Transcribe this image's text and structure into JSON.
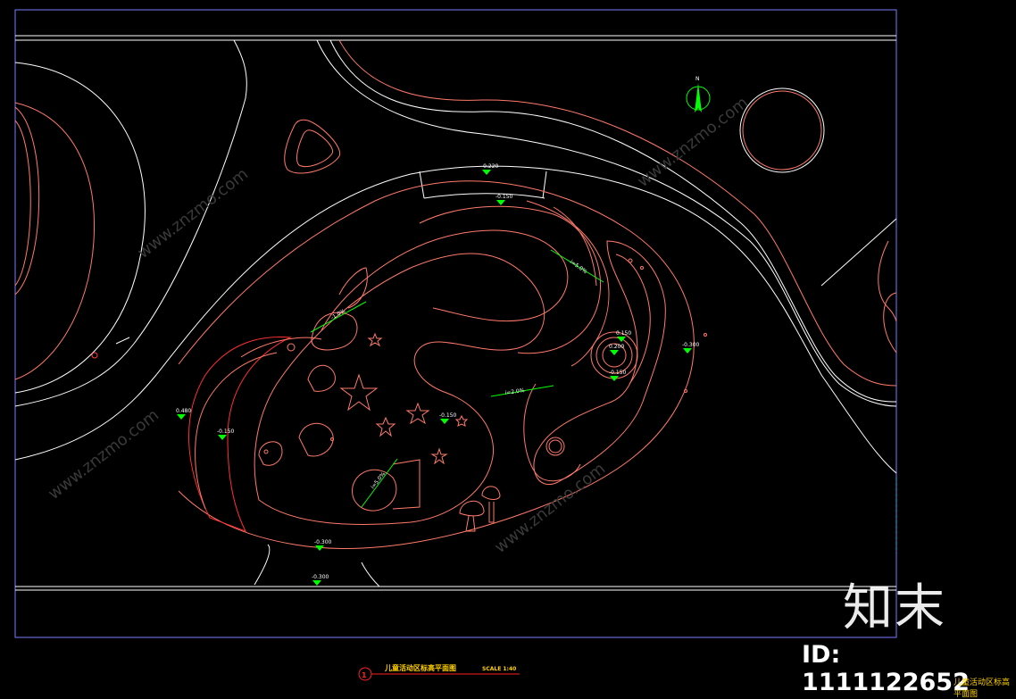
{
  "drawing": {
    "title": "儿童活动区标高平面图",
    "scale": "SCALE 1:40",
    "index_number": "1",
    "colors": {
      "boundary": "#ffffff",
      "frame": "#7a7aff",
      "plan": "#ff7a6a",
      "elevation_marker": "#00ff00",
      "label": "#ffffff",
      "title": "#ffd000",
      "index_circle": "#ff2020"
    },
    "north_arrow_label": "N"
  },
  "elevations": [
    "-0.220",
    "-0.150",
    "-0.150",
    "0.480",
    "-0.150",
    "0.200",
    "-0.150",
    "0.150",
    "-0.150",
    "-0.300",
    "-0.300",
    "-0.300",
    "-0.300"
  ],
  "slopes": [
    "-1.0%",
    "i=5.0%",
    "i=2.0%",
    "i=5.0%"
  ],
  "watermark": {
    "brand": "知末",
    "id": "ID: 1111122652",
    "caption": "儿童活动区标高平面图",
    "tag": "www.znzmo.com"
  }
}
